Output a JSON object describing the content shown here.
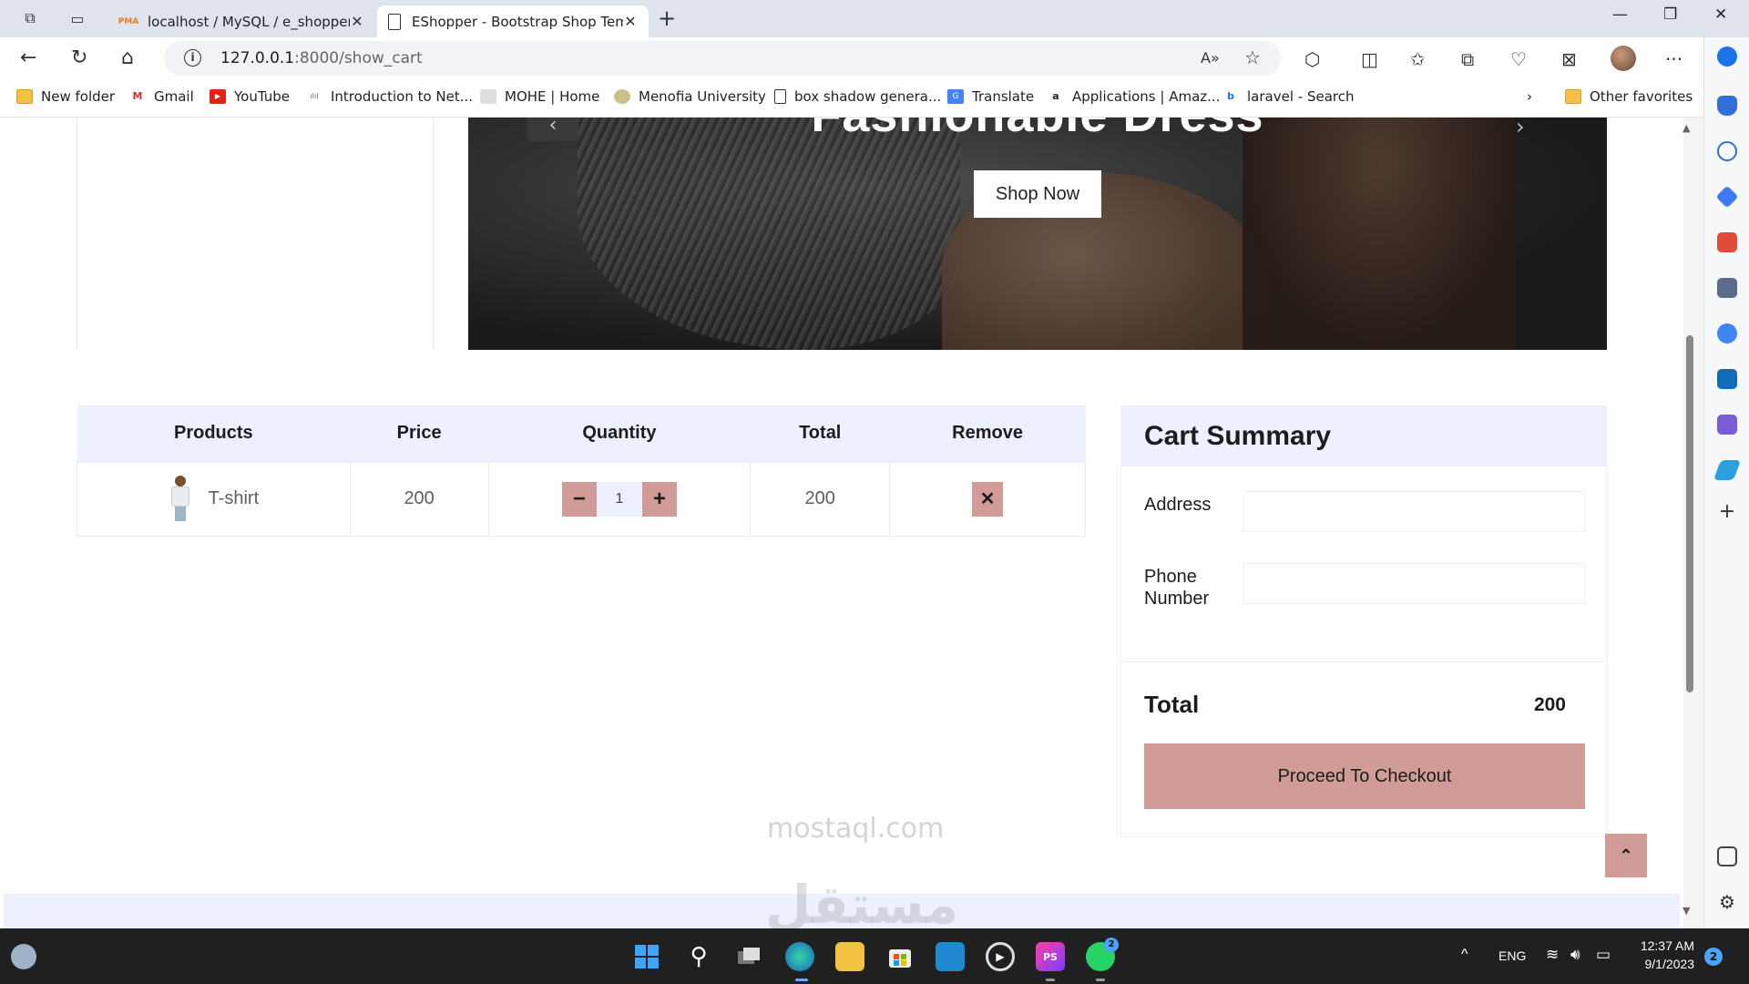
{
  "browser": {
    "tabs": [
      {
        "title": "localhost / MySQL / e_shopper /",
        "favicon": "phpmyadmin-icon"
      },
      {
        "title": "EShopper - Bootstrap Shop Temp",
        "favicon": "page-icon"
      }
    ],
    "url_host": "127.0.0.1",
    "url_path": ":8000/show_cart",
    "favorites": [
      {
        "label": "New folder",
        "icon": "folder-icon"
      },
      {
        "label": "Gmail",
        "icon": "gmail-icon"
      },
      {
        "label": "YouTube",
        "icon": "youtube-icon"
      },
      {
        "label": "Introduction to Net...",
        "icon": "cisco-icon"
      },
      {
        "label": "MOHE | Home",
        "icon": "mohe-icon"
      },
      {
        "label": "Menofia University",
        "icon": "menofia-icon"
      },
      {
        "label": "box shadow genera...",
        "icon": "page-icon"
      },
      {
        "label": "Translate",
        "icon": "translate-icon"
      },
      {
        "label": "Applications | Amaz...",
        "icon": "amazon-icon"
      },
      {
        "label": "laravel - Search",
        "icon": "bing-icon"
      }
    ],
    "other_favorites": "Other favorites"
  },
  "hero": {
    "headline": "Fashionable Dress",
    "cta": "Shop Now"
  },
  "cart": {
    "headers": [
      "Products",
      "Price",
      "Quantity",
      "Total",
      "Remove"
    ],
    "rows": [
      {
        "product": "T-shirt",
        "price": "200",
        "quantity": "1",
        "total": "200"
      }
    ],
    "minus_label": "−",
    "plus_label": "+",
    "remove_label": "✕"
  },
  "summary": {
    "title": "Cart Summary",
    "address_label": "Address",
    "phone_label": "Phone Number",
    "address_value": "",
    "phone_value": "",
    "total_label": "Total",
    "total_value": "200",
    "checkout_label": "Proceed To Checkout"
  },
  "back_to_top": "⌃",
  "watermark": {
    "line1": "مستقل",
    "line2": "mostaql.com"
  },
  "taskbar": {
    "language": "ENG",
    "time": "12:37 AM",
    "date": "9/1/2023",
    "notification_count": "2",
    "whatsapp_badge": "2"
  },
  "colors": {
    "accent": "#d19c97",
    "light_blue": "#edf1ff",
    "text_dark": "#1c1c1c"
  }
}
